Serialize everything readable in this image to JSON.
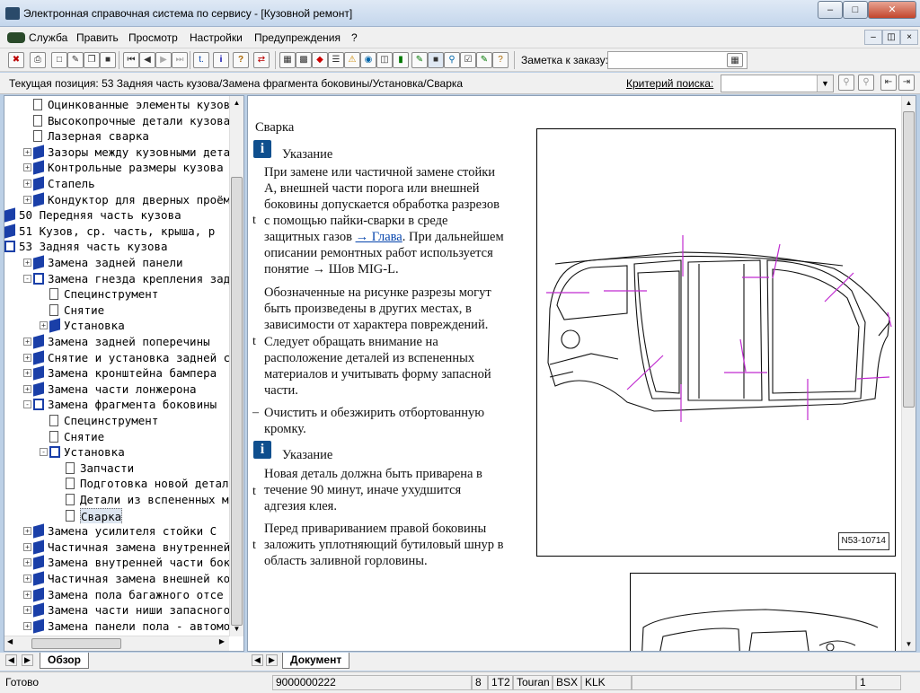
{
  "window": {
    "title": "Электронная справочная система по сервису - [Кузовной ремонт]"
  },
  "menu": [
    "Служба",
    "Править",
    "Просмотр",
    "Настройки",
    "Предупреждения",
    "?"
  ],
  "toolbar": {
    "note_label": "Заметка к заказу:"
  },
  "position": {
    "label": "Текущая позиция: 53 Задняя часть кузова/Замена фрагмента боковины/Установка/Сварка",
    "search_label": "Критерий поиска:"
  },
  "tree": [
    {
      "text": "Оцинкованные элементы кузов",
      "indent": 1,
      "box": "",
      "type": "page"
    },
    {
      "text": "Высокопрочные детали кузова",
      "indent": 1,
      "box": "",
      "type": "page"
    },
    {
      "text": "Лазерная сварка",
      "indent": 1,
      "box": "",
      "type": "page"
    },
    {
      "text": "Зазоры между кузовными дета",
      "indent": 1,
      "box": "+",
      "type": "book"
    },
    {
      "text": "Контрольные размеры кузова",
      "indent": 1,
      "box": "+",
      "type": "book"
    },
    {
      "text": "Стапель",
      "indent": 1,
      "box": "+",
      "type": "book"
    },
    {
      "text": "Кондуктор для дверных проём",
      "indent": 1,
      "box": "+",
      "type": "book"
    },
    {
      "text": "50 Передняя часть кузова",
      "indent": 0,
      "box": "",
      "type": "book"
    },
    {
      "text": "51 Кузов, ср. часть, крыша, р",
      "indent": 0,
      "box": "",
      "type": "book"
    },
    {
      "text": "53 Задняя часть кузова",
      "indent": 0,
      "box": "",
      "type": "open"
    },
    {
      "text": "Замена задней панели",
      "indent": 1,
      "box": "+",
      "type": "book"
    },
    {
      "text": "Замена гнезда крепления зад",
      "indent": 1,
      "box": "-",
      "type": "open"
    },
    {
      "text": "Специнструмент",
      "indent": 2,
      "box": "",
      "type": "page"
    },
    {
      "text": "Снятие",
      "indent": 2,
      "box": "",
      "type": "page"
    },
    {
      "text": "Установка",
      "indent": 2,
      "box": "+",
      "type": "book"
    },
    {
      "text": "Замена задней поперечины",
      "indent": 1,
      "box": "+",
      "type": "book"
    },
    {
      "text": "Снятие и установка задней с",
      "indent": 1,
      "box": "+",
      "type": "book"
    },
    {
      "text": "Замена кронштейна бампера",
      "indent": 1,
      "box": "+",
      "type": "book"
    },
    {
      "text": "Замена части лонжерона",
      "indent": 1,
      "box": "+",
      "type": "book"
    },
    {
      "text": "Замена фрагмента боковины",
      "indent": 1,
      "box": "-",
      "type": "open"
    },
    {
      "text": "Специнструмент",
      "indent": 2,
      "box": "",
      "type": "page"
    },
    {
      "text": "Снятие",
      "indent": 2,
      "box": "",
      "type": "page"
    },
    {
      "text": "Установка",
      "indent": 2,
      "box": "-",
      "type": "open"
    },
    {
      "text": "Запчасти",
      "indent": 3,
      "box": "",
      "type": "page"
    },
    {
      "text": "Подготовка новой детал",
      "indent": 3,
      "box": "",
      "type": "page"
    },
    {
      "text": "Детали из вспененных м",
      "indent": 3,
      "box": "",
      "type": "page"
    },
    {
      "text": "Сварка",
      "indent": 3,
      "box": "",
      "type": "page",
      "selected": true
    },
    {
      "text": "Замена усилителя стойки С",
      "indent": 1,
      "box": "+",
      "type": "book"
    },
    {
      "text": "Частичная замена внутренней",
      "indent": 1,
      "box": "+",
      "type": "book"
    },
    {
      "text": "Замена внутренней части бок",
      "indent": 1,
      "box": "+",
      "type": "book"
    },
    {
      "text": "Частичная замена внешней ко",
      "indent": 1,
      "box": "+",
      "type": "book"
    },
    {
      "text": "Замена пола багажного отсе",
      "indent": 1,
      "box": "+",
      "type": "book"
    },
    {
      "text": "Замена части ниши запасного",
      "indent": 1,
      "box": "+",
      "type": "book"
    },
    {
      "text": "Замена панели пола - автомо",
      "indent": 1,
      "box": "+",
      "type": "book"
    }
  ],
  "doc": {
    "heading": "Сварка",
    "note1_title": "Указание",
    "p1_lines": [
      "При замене или частичной замене стойки",
      "А, внешней части порога или внешней",
      "боковины допускается обработка разрезов",
      "с помощью пайки-сварки в среде"
    ],
    "p1_l5_pre": "защитных газов ",
    "p1_link": "→ Глава",
    "p1_l5_post": ". При дальнейшем",
    "p1_lines2": [
      "описании ремонтных работ используется",
      "понятие → Шов MIG-L."
    ],
    "p2_lines": [
      "Обозначенные на рисунке разрезы могут",
      "быть произведены в других местах, в",
      "зависимости от характера повреждений."
    ],
    "p3_lines": [
      "Следует обращать внимание на",
      "расположение деталей из вспененных",
      "материалов и учитывать форму запасной",
      "части."
    ],
    "p4_lines": [
      "Очистить и обезжирить отбортованную",
      "кромку."
    ],
    "note2_title": "Указание",
    "p5_lines": [
      "Новая деталь должна быть приварена в",
      "течение 90 минут, иначе ухудшится",
      "адгезия клея."
    ],
    "p6_lines": [
      "Перед привариванием правой боковины",
      "заложить уплотняющий бутиловый шнур в",
      "область заливной горловины."
    ],
    "marker_t": "t",
    "marker_dash": "–",
    "figure_id": "N53-10714"
  },
  "tabs": {
    "left": "Обзор",
    "right": "Документ"
  },
  "status": {
    "ready": "Готово",
    "order": "9000000222",
    "f1": "8",
    "f2": "1T2",
    "f3": "Touran",
    "f4": "BSX",
    "f5": "KLK",
    "page": "1"
  }
}
